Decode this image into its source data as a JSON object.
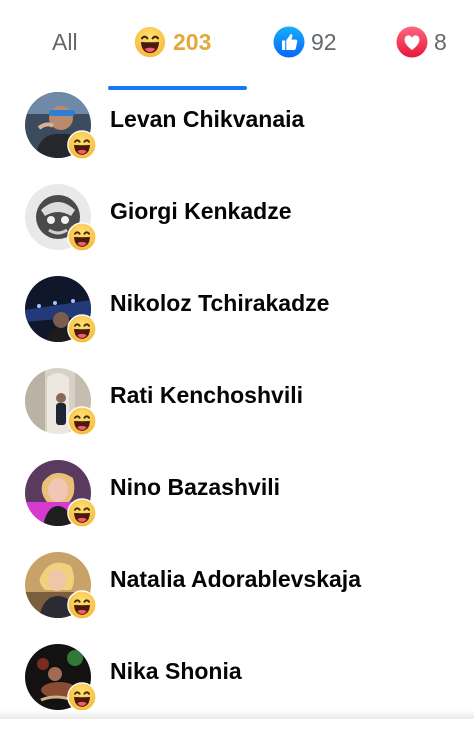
{
  "tabs": {
    "all_label": "All",
    "haha_count": "203",
    "like_count": "92",
    "love_count": "8"
  },
  "people": [
    {
      "name": "Levan Chikvanaia",
      "reaction": "haha-icon"
    },
    {
      "name": "Giorgi Kenkadze",
      "reaction": "haha-icon"
    },
    {
      "name": "Nikoloz Tchirakadze",
      "reaction": "haha-icon"
    },
    {
      "name": "Rati Kenchoshvili",
      "reaction": "haha-icon"
    },
    {
      "name": "Nino Bazashvili",
      "reaction": "haha-icon"
    },
    {
      "name": "Natalia Adorablevskaja",
      "reaction": "haha-icon"
    },
    {
      "name": "Nika Shonia",
      "reaction": "haha-icon"
    }
  ],
  "colors": {
    "accent": "#1877f2",
    "haha": "#e3a93c",
    "love": "#f0284a",
    "muted": "#65676b"
  }
}
